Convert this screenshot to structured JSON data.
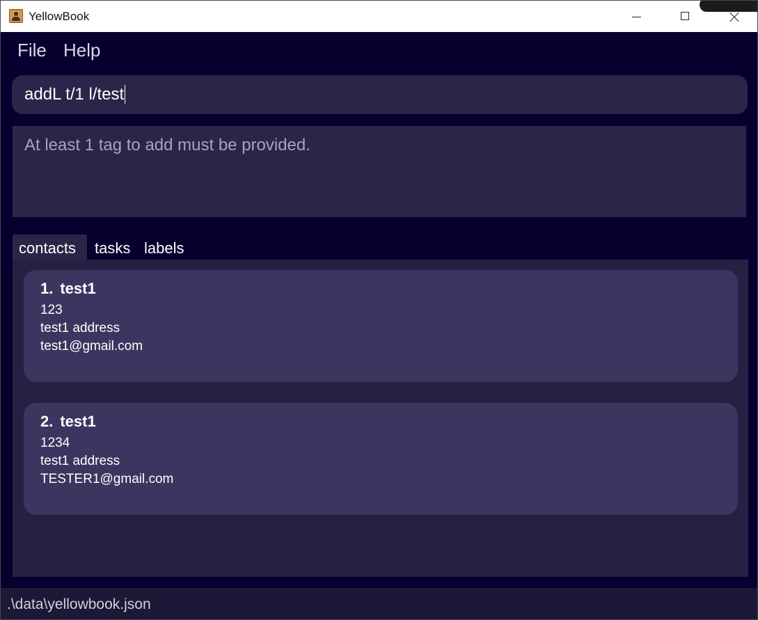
{
  "window": {
    "title": "YellowBook",
    "icon": "contact-book-icon"
  },
  "menu": {
    "file_label": "File",
    "help_label": "Help"
  },
  "command_box": {
    "value": "addL t/1 l/test"
  },
  "result_display": {
    "message": "At least 1 tag to add must be provided."
  },
  "tabs": [
    {
      "label": "contacts",
      "selected": true
    },
    {
      "label": "tasks",
      "selected": false
    },
    {
      "label": "labels",
      "selected": false
    }
  ],
  "contacts": [
    {
      "index": "1.",
      "name": "test1",
      "phone": "123",
      "address": "test1 address",
      "email": "test1@gmail.com"
    },
    {
      "index": "2.",
      "name": "test1",
      "phone": "1234",
      "address": "test1 address",
      "email": "TESTER1@gmail.com"
    }
  ],
  "status_bar": {
    "path": ".\\data\\yellowbook.json"
  },
  "colors": {
    "background": "#07002f",
    "panel": "#2b2549",
    "card": "#3c3560",
    "text": "#ffffff"
  }
}
